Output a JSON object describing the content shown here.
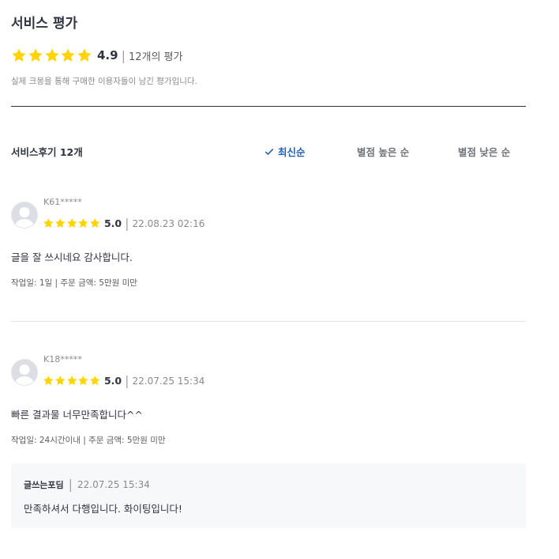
{
  "header": {
    "title": "서비스 평가",
    "score": "4.9",
    "separator": "|",
    "count_text": "12개의 평가",
    "subtitle": "실제 크몽을 통해 구매한 이용자들이 남긴 평가입니다.",
    "star_color": "#ffd400"
  },
  "reviews_header": {
    "label": "서비스후기 12개",
    "sort_options": [
      {
        "label": "최신순",
        "active": true
      },
      {
        "label": "별점 높은 순",
        "active": false
      },
      {
        "label": "별점 낮은 순",
        "active": false
      }
    ],
    "active_color": "#1f5fb4"
  },
  "reviews": [
    {
      "username": "K61*****",
      "score": "5.0",
      "separator": "|",
      "date": "22.08.23 02:16",
      "text": "글을 잘 쓰시네요 감사합니다.",
      "work_info": "작업일: 1일 | 주문 금액: 5만원 미만",
      "avatar": "default-user-avatar"
    },
    {
      "username": "K18*****",
      "score": "5.0",
      "separator": "|",
      "date": "22.07.25 15:34",
      "text": "빠른 결과물 너무만족합니다^^",
      "work_info": "작업일: 24시간이내 | 주문 금액: 5만원 미만",
      "avatar": "default-user-avatar",
      "reply": {
        "author": "글쓰는포딤",
        "separator": "|",
        "date": "22.07.25 15:34",
        "text": "만족하셔서 다행입니다. 화이팅입니다!"
      }
    }
  ]
}
